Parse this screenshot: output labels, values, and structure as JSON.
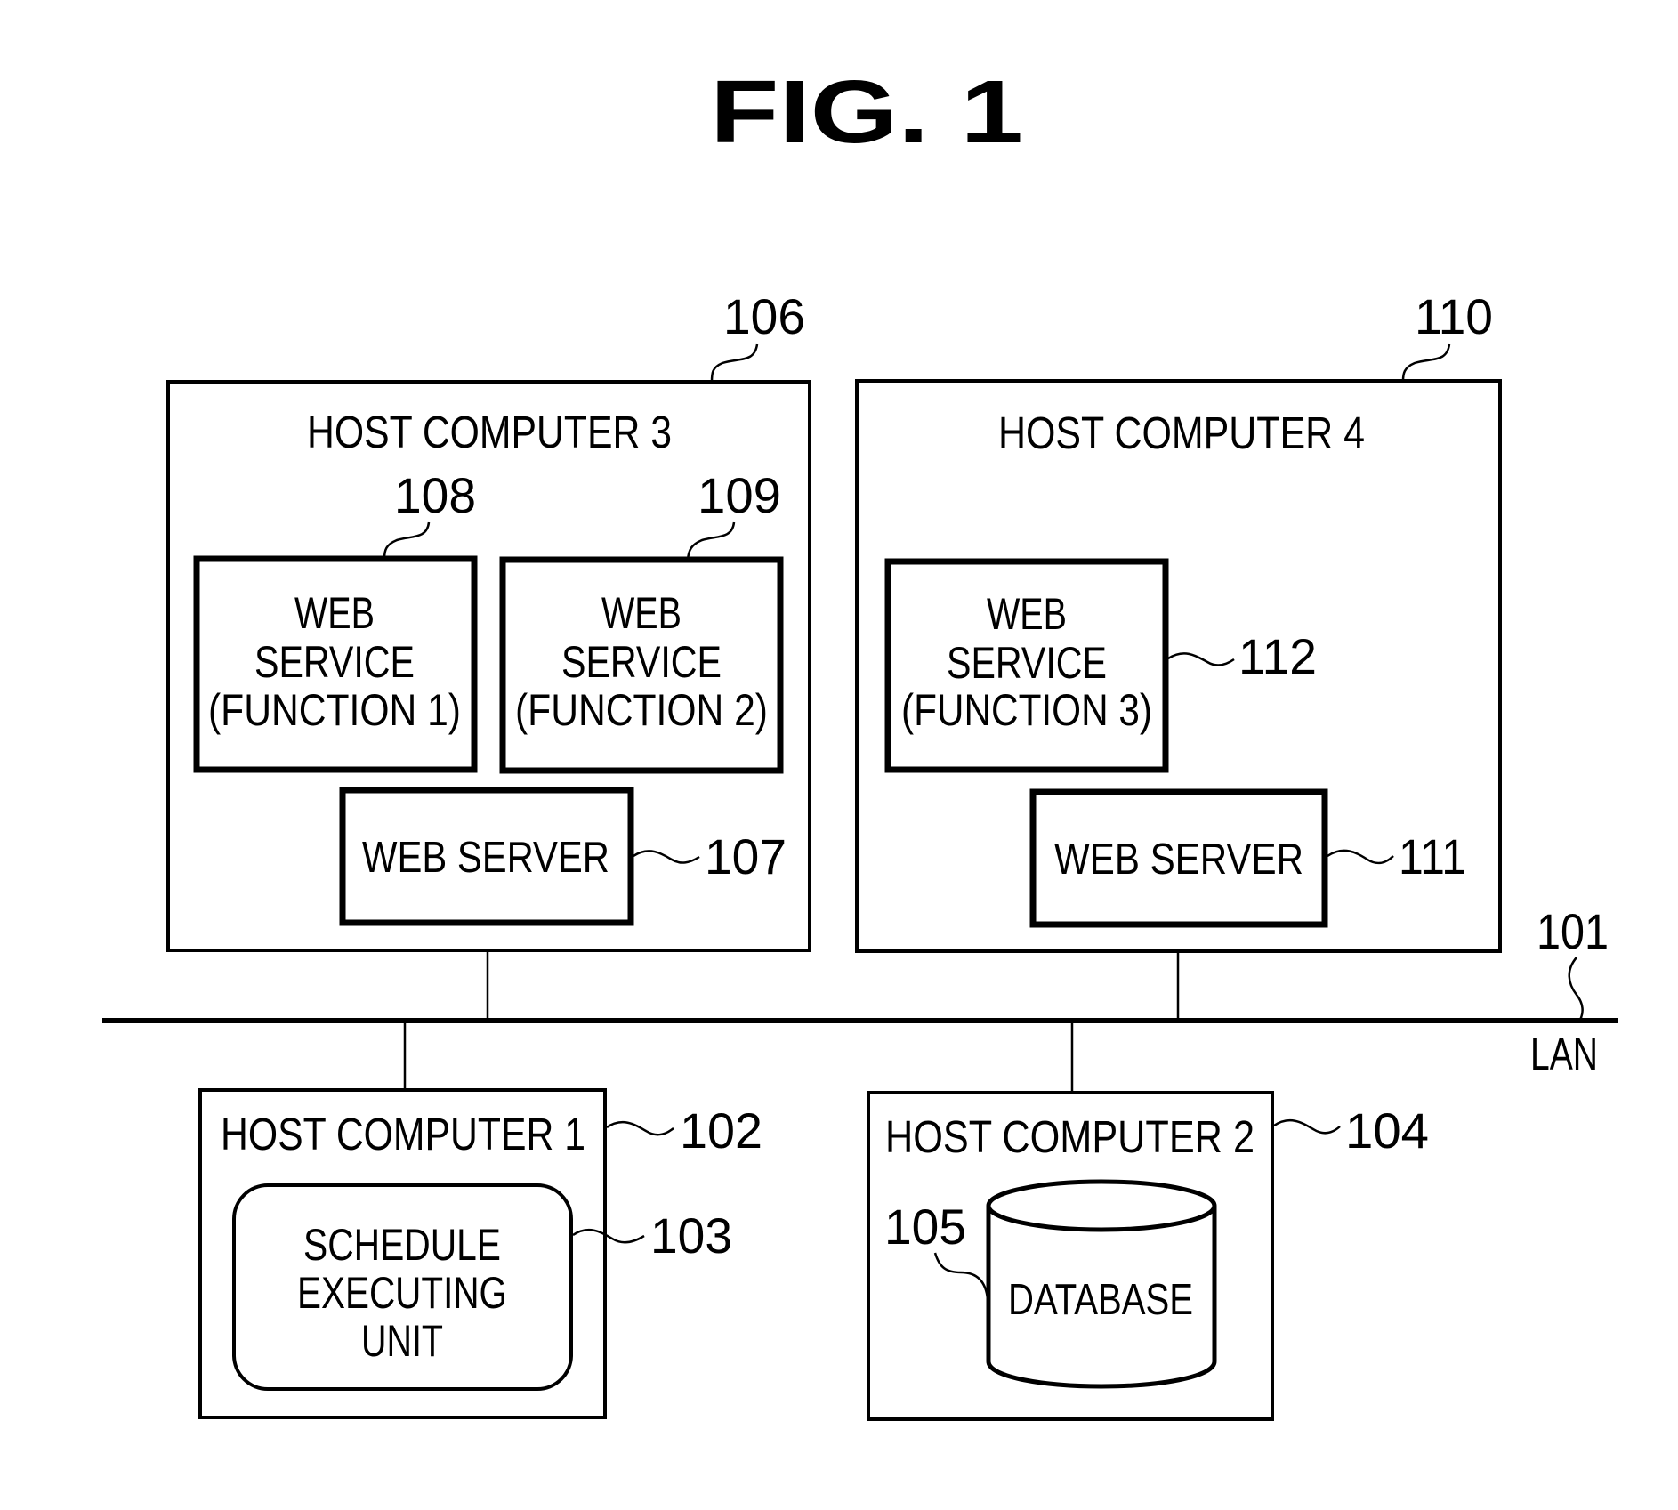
{
  "figure": {
    "title": "FIG. 1"
  },
  "network": {
    "label": "LAN",
    "ref": "101"
  },
  "host_computer_3": {
    "ref": "106",
    "title": "HOST  COMPUTER  3",
    "web_service_1": {
      "ref": "108",
      "lines": [
        "WEB",
        "SERVICE",
        "(FUNCTION  1)"
      ]
    },
    "web_service_2": {
      "ref": "109",
      "lines": [
        "WEB",
        "SERVICE",
        "(FUNCTION  2)"
      ]
    },
    "web_server": {
      "ref": "107",
      "label": "WEB  SERVER"
    }
  },
  "host_computer_4": {
    "ref": "110",
    "title": "HOST  COMPUTER  4",
    "web_service_3": {
      "ref": "112",
      "lines": [
        "WEB",
        "SERVICE",
        "(FUNCTION  3)"
      ]
    },
    "web_server": {
      "ref": "111",
      "label": "WEB  SERVER"
    }
  },
  "host_computer_1": {
    "ref": "102",
    "title": "HOST  COMPUTER  1",
    "schedule_unit": {
      "ref": "103",
      "lines": [
        "SCHEDULE",
        "EXECUTING",
        "UNIT"
      ]
    }
  },
  "host_computer_2": {
    "ref": "104",
    "title": "HOST  COMPUTER  2",
    "database": {
      "ref": "105",
      "label": "DATABASE"
    }
  }
}
